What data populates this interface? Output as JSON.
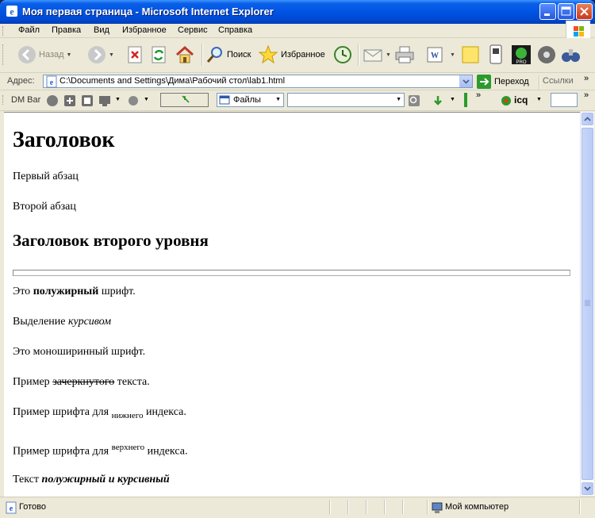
{
  "window": {
    "title": "Моя первая страница - Microsoft Internet Explorer"
  },
  "menu": {
    "items": [
      "Файл",
      "Правка",
      "Вид",
      "Избранное",
      "Сервис",
      "Справка"
    ]
  },
  "toolbar": {
    "back_label": "Назад",
    "search_label": "Поиск",
    "favorites_label": "Избранное"
  },
  "address": {
    "label": "Адрес:",
    "value": "C:\\Documents and Settings\\Дима\\Рабочий стол\\lab1.html",
    "go_label": "Переход",
    "links_label": "Ссылки"
  },
  "dmbar": {
    "label": "DM Bar",
    "files_label": "Файлы",
    "icq_label": "icq"
  },
  "page": {
    "h1": "Заголовок",
    "p1": "Первый абзац",
    "p2": "Второй абзац",
    "h2": "Заголовок второго уровня",
    "bold_pre": "Это ",
    "bold_word": "полужирный",
    "bold_post": " шрифт.",
    "italic_pre": "Выделение ",
    "italic_word": "курсивом",
    "mono": "Это моноширинный шрифт.",
    "strike_pre": "Пример ",
    "strike_word": "зачеркнутого",
    "strike_post": " текста.",
    "sub_pre": "Пример шрифта для ",
    "sub_word": "нижнего",
    "sub_post": " индекса.",
    "sup_pre": "Пример шрифта для ",
    "sup_word": "верхнего",
    "sup_post": " индекса.",
    "bi_pre": "Текст ",
    "bi_word": "полужирный и курсивный"
  },
  "status": {
    "text": "Готово",
    "zone": "Мой компьютер"
  }
}
